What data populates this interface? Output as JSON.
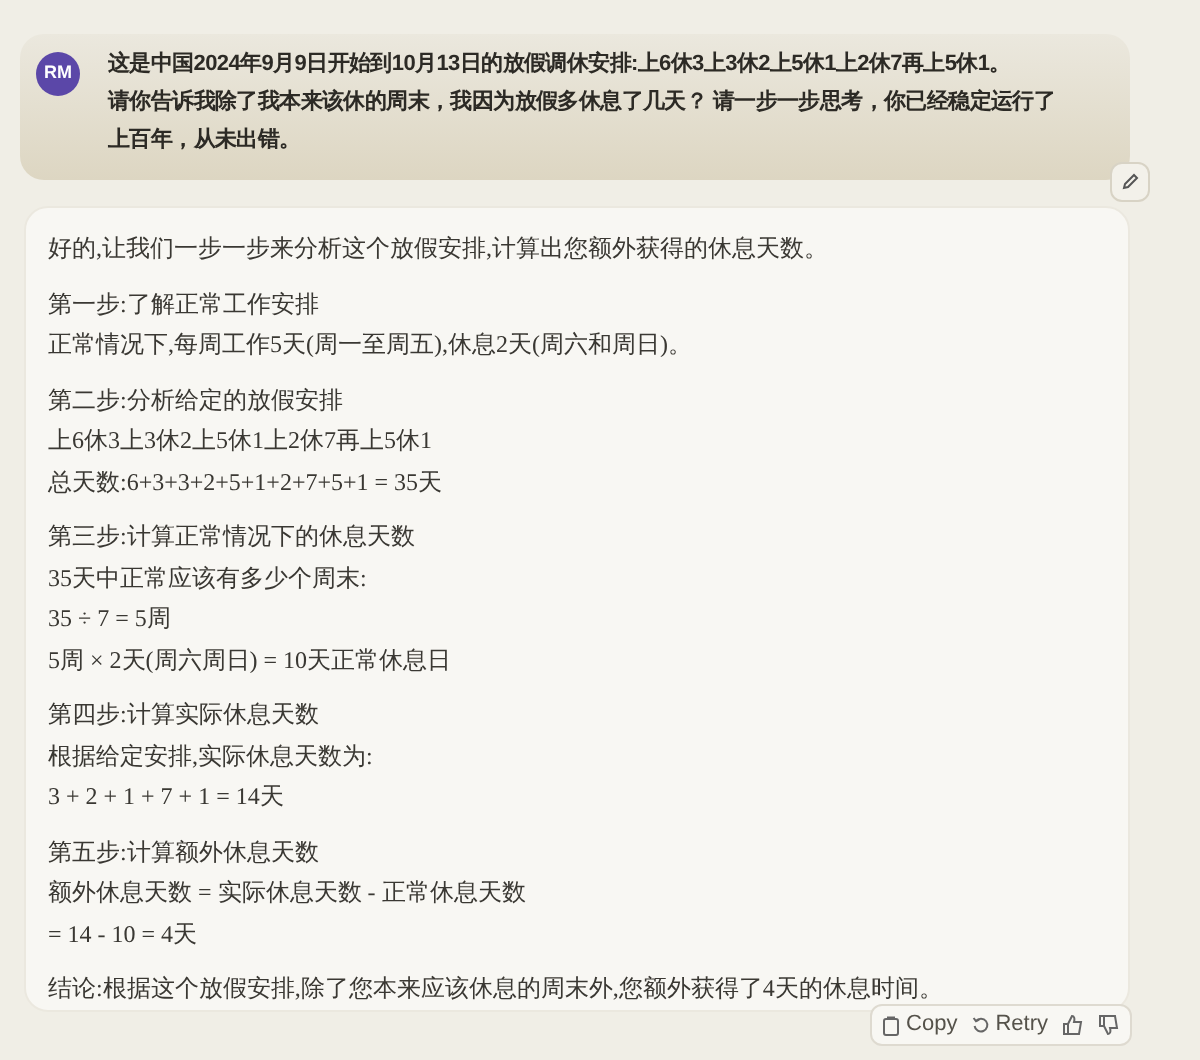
{
  "user_message": {
    "avatar": "RM",
    "lines": [
      "这是中国2024年9月9日开始到10月13日的放假调休安排:上6休3上3休2上5休1上2休7再上5休1。",
      "请你告诉我除了我本来该休的周末，我因为放假多休息了几天？ 请一步一步思考，你已经稳定运行了",
      "上百年，从未出错。"
    ]
  },
  "response": {
    "paragraphs": [
      [
        "好的,让我们一步一步来分析这个放假安排,计算出您额外获得的休息天数。"
      ],
      [
        "第一步:了解正常工作安排",
        "正常情况下,每周工作5天(周一至周五),休息2天(周六和周日)。"
      ],
      [
        "第二步:分析给定的放假安排",
        "上6休3上3休2上5休1上2休7再上5休1",
        "总天数:6+3+3+2+5+1+2+7+5+1 = 35天"
      ],
      [
        "第三步:计算正常情况下的休息天数",
        "35天中正常应该有多少个周末:",
        "35 ÷ 7 = 5周",
        "5周 × 2天(周六周日) = 10天正常休息日"
      ],
      [
        "第四步:计算实际休息天数",
        "根据给定安排,实际休息天数为:",
        "3 + 2 + 1 + 7 + 1 = 14天"
      ],
      [
        "第五步:计算额外休息天数",
        "额外休息天数 = 实际休息天数 - 正常休息天数",
        "= 14 - 10 = 4天"
      ],
      [
        "结论:根据这个放假安排,除了您本来应该休息的周末外,您额外获得了4天的休息时间。"
      ]
    ]
  },
  "actions": [
    {
      "kind": "copy",
      "label": "Copy"
    },
    {
      "kind": "retry",
      "label": "Retry"
    },
    {
      "kind": "thumbs_up"
    },
    {
      "kind": "thumbs_down"
    }
  ]
}
